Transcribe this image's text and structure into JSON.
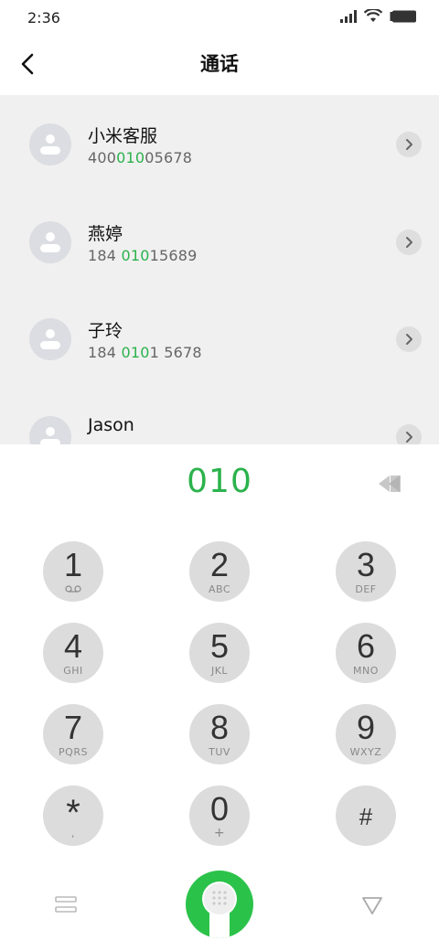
{
  "status_bar": {
    "time": "2:36"
  },
  "header": {
    "title": "通话"
  },
  "contacts": [
    {
      "name": "小米客服",
      "number_parts": [
        "400",
        "010",
        "05678"
      ]
    },
    {
      "name": "燕婷",
      "number_parts": [
        "184 ",
        "010",
        "15689"
      ]
    },
    {
      "name": "子玲",
      "number_parts": [
        "184 ",
        "010",
        "1 5678"
      ]
    },
    {
      "name": "Jason",
      "number_parts": [
        "",
        "",
        ""
      ]
    }
  ],
  "dial_input": {
    "value": "010"
  },
  "keypad": [
    {
      "digit": "1",
      "letters": ""
    },
    {
      "digit": "2",
      "letters": "ABC"
    },
    {
      "digit": "3",
      "letters": "DEF"
    },
    {
      "digit": "4",
      "letters": "GHI"
    },
    {
      "digit": "5",
      "letters": "JKL"
    },
    {
      "digit": "6",
      "letters": "MNO"
    },
    {
      "digit": "7",
      "letters": "PQRS"
    },
    {
      "digit": "8",
      "letters": "TUV"
    },
    {
      "digit": "9",
      "letters": "WXYZ"
    },
    {
      "digit": "*",
      "letters": ","
    },
    {
      "digit": "0",
      "letters": "+"
    },
    {
      "digit": "#",
      "letters": ""
    }
  ],
  "icons": {
    "back": "chevron-left-icon",
    "chevron": "chevron-right-icon",
    "backspace": "backspace-icon",
    "voicemail": "voicemail-icon",
    "menu": "menu-icon",
    "call": "phone-icon",
    "collapse": "collapse-keypad-icon"
  },
  "colors": {
    "accent": "#2bb24c",
    "call_button": "#2bc24a",
    "list_background": "#f0f0f0",
    "key_background": "#dcdcdc"
  }
}
